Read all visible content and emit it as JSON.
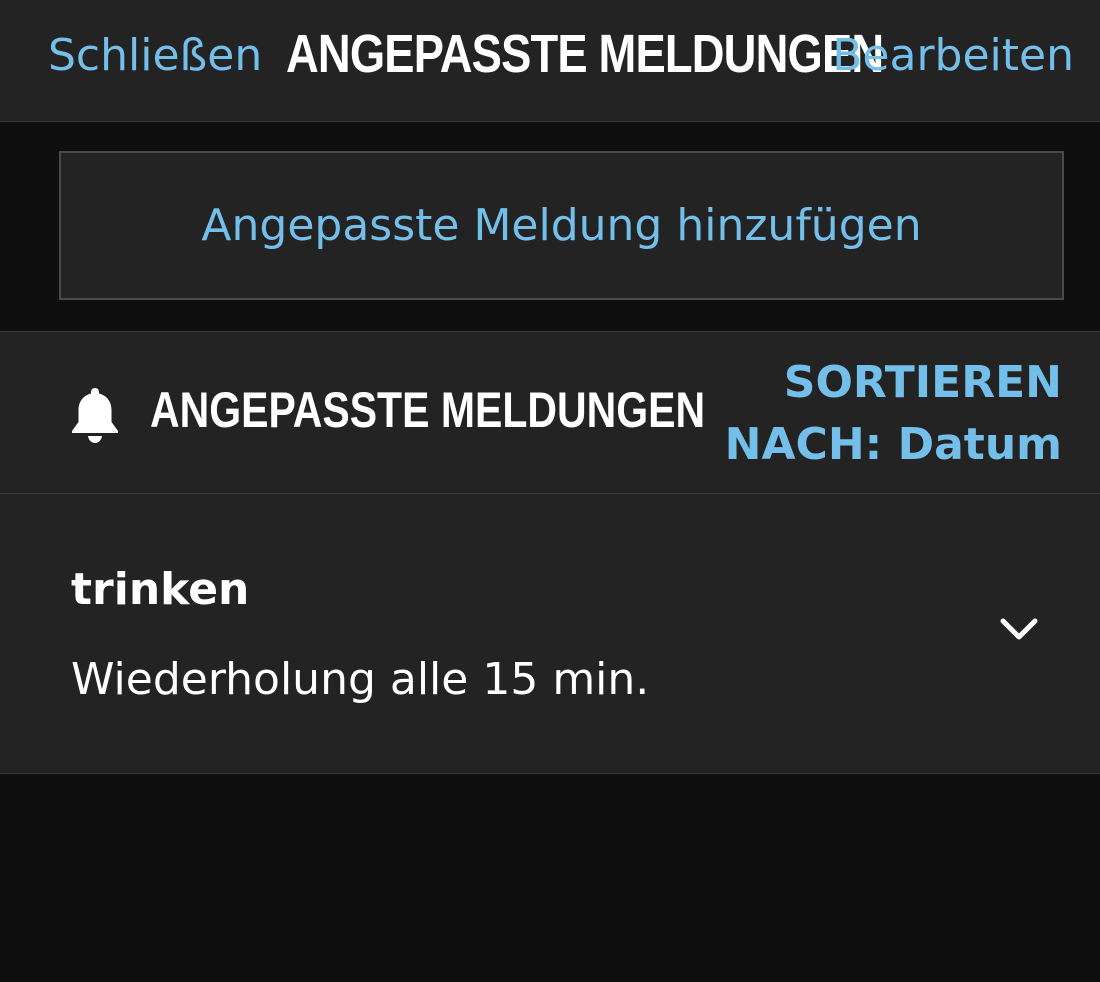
{
  "nav": {
    "close_label": "Schließen",
    "title": "ANGEPASSTE MELDUNGEN",
    "edit_label": "Bearbeiten"
  },
  "add_button": {
    "label": "Angepasste Meldung hinzufügen"
  },
  "section": {
    "icon": "bell-icon",
    "title": "ANGEPASSTE MELDUNGEN",
    "sort_line1": "SORTIEREN",
    "sort_line2": "NACH: Datum"
  },
  "notifications": [
    {
      "title": "trinken",
      "subtitle": "Wiederholung alle 15 min.",
      "icon": "chevron-down-icon"
    }
  ],
  "colors": {
    "accent": "#73bfea",
    "bar_background": "#232323",
    "page_background": "#0f0f0f",
    "text": "#ffffff"
  }
}
